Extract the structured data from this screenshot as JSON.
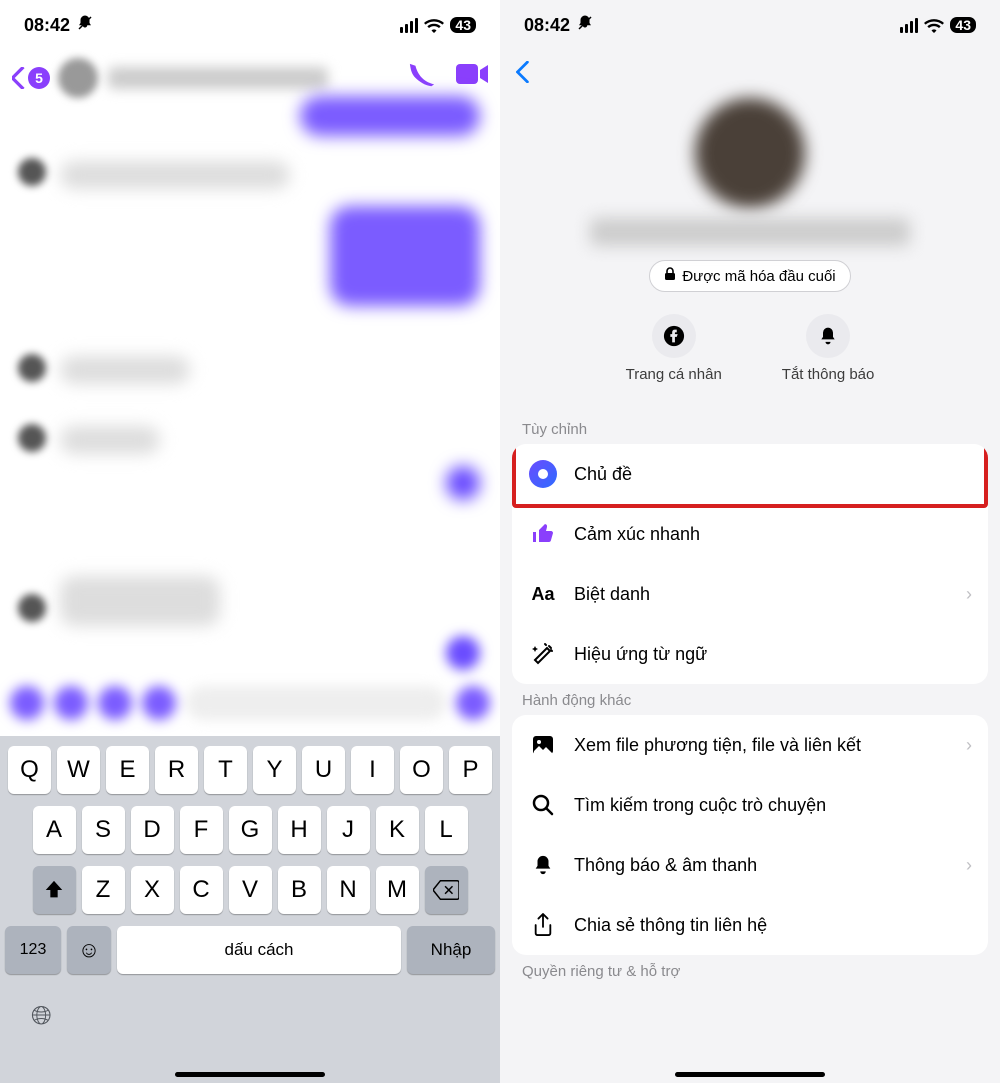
{
  "status": {
    "time": "08:42",
    "battery": "43"
  },
  "left": {
    "unread_badge": "5",
    "keyboard": {
      "row1": [
        "Q",
        "W",
        "E",
        "R",
        "T",
        "Y",
        "U",
        "I",
        "O",
        "P"
      ],
      "row2": [
        "A",
        "S",
        "D",
        "F",
        "G",
        "H",
        "J",
        "K",
        "L"
      ],
      "row3": [
        "Z",
        "X",
        "C",
        "V",
        "B",
        "N",
        "M"
      ],
      "numeric_key": "123",
      "space_label": "dấu cách",
      "enter_label": "Nhập"
    }
  },
  "right": {
    "encrypted_label": "Được mã hóa đầu cuối",
    "actions": {
      "profile": "Trang cá nhân",
      "mute": "Tắt thông báo"
    },
    "sections": {
      "customize_title": "Tùy chỉnh",
      "customize": {
        "theme": "Chủ đề",
        "quick_react": "Cảm xúc nhanh",
        "nickname": "Biệt danh",
        "word_effects": "Hiệu ứng từ ngữ"
      },
      "more_title": "Hành động khác",
      "more": {
        "media": "Xem file phương tiện, file và liên kết",
        "search": "Tìm kiếm trong cuộc trò chuyện",
        "notifications": "Thông báo & âm thanh",
        "share": "Chia sẻ thông tin liên hệ"
      },
      "privacy_title": "Quyền riêng tư & hỗ trợ"
    }
  }
}
